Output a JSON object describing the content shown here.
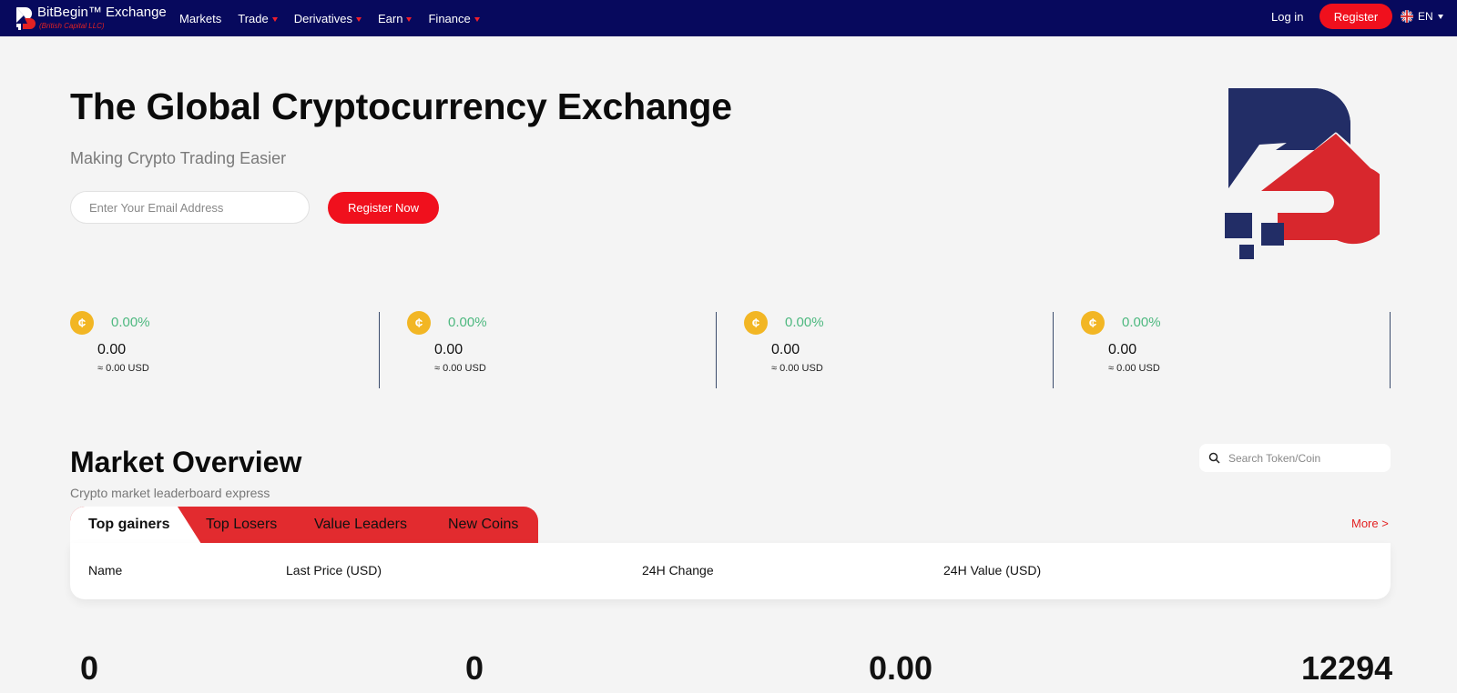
{
  "nav": {
    "brand_name": "BitBegin™ Exchange",
    "brand_sub": "(British Capital LLC)",
    "links": [
      {
        "label": "Markets",
        "has_dropdown": false
      },
      {
        "label": "Trade",
        "has_dropdown": true
      },
      {
        "label": "Derivatives",
        "has_dropdown": true
      },
      {
        "label": "Earn",
        "has_dropdown": true
      },
      {
        "label": "Finance",
        "has_dropdown": true
      }
    ],
    "login": "Log in",
    "register": "Register",
    "language": "EN"
  },
  "hero": {
    "title": "The Global Cryptocurrency Exchange",
    "subtitle": "Making Crypto Trading Easier",
    "email_placeholder": "Enter Your Email Address",
    "register_now": "Register Now"
  },
  "tickers": [
    {
      "change": "0.00%",
      "price": "0.00",
      "usd": "≈ 0.00 USD"
    },
    {
      "change": "0.00%",
      "price": "0.00",
      "usd": "≈ 0.00 USD"
    },
    {
      "change": "0.00%",
      "price": "0.00",
      "usd": "≈ 0.00 USD"
    },
    {
      "change": "0.00%",
      "price": "0.00",
      "usd": "≈ 0.00 USD"
    }
  ],
  "market": {
    "title": "Market Overview",
    "subtitle": "Crypto market leaderboard express",
    "search_placeholder": "Search Token/Coin",
    "tabs": [
      "Top gainers",
      "Top Losers",
      "Value Leaders",
      "New Coins"
    ],
    "more": "More >",
    "columns": [
      "Name",
      "Last Price (USD)",
      "24H Change",
      "24H Value (USD)"
    ]
  },
  "stats": [
    "0",
    "0",
    "0.00",
    "12294"
  ],
  "colors": {
    "nav_bg": "#07095d",
    "accent_red": "#f0101d",
    "positive_green": "#4db87f",
    "coin_gold": "#f2b624",
    "logo_navy": "#222d66"
  }
}
